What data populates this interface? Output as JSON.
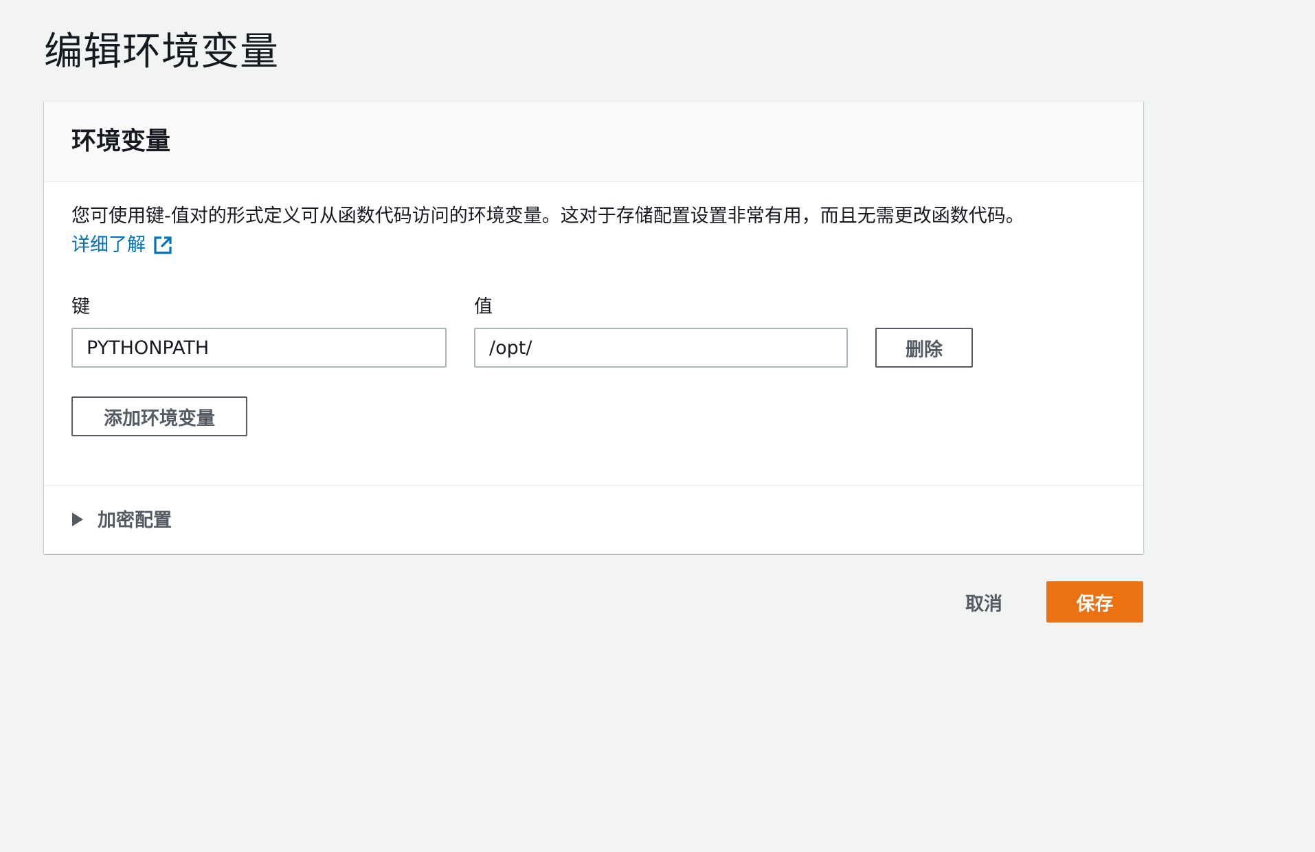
{
  "page": {
    "title": "编辑环境变量"
  },
  "panel": {
    "title": "环境变量",
    "description": "您可使用键-值对的形式定义可从函数代码访问的环境变量。这对于存储配置设置非常有用，而且无需更改函数代码。",
    "learn_more_label": "详细了解",
    "learn_more_icon": "external-link-icon",
    "key_label": "键",
    "value_label": "值",
    "variables": [
      {
        "key": "PYTHONPATH",
        "value": "/opt/",
        "remove_label": "删除"
      }
    ],
    "add_label": "添加环境变量",
    "encryption": {
      "label": "加密配置",
      "icon": "caret-right-icon",
      "expanded": false
    }
  },
  "footer": {
    "cancel_label": "取消",
    "save_label": "保存"
  },
  "colors": {
    "background": "#f2f3f3",
    "link": "#0073bb",
    "primary": "#ec7211",
    "secondary_text": "#545b64",
    "input_border": "#aab7b8"
  }
}
